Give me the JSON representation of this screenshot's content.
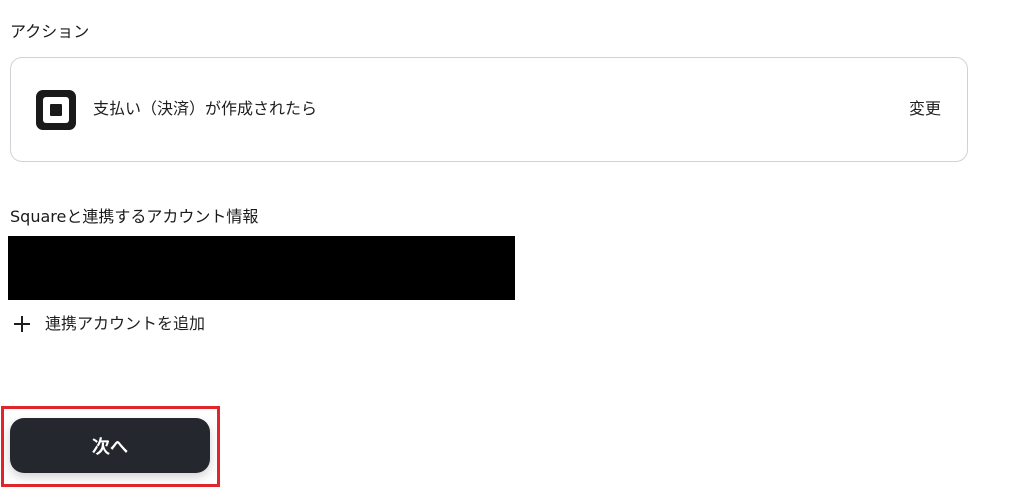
{
  "action_section": {
    "label": "アクション",
    "card": {
      "app_icon": "square-logo-icon",
      "title": "支払い（決済）が作成されたら",
      "change_label": "変更"
    }
  },
  "account_section": {
    "label": "Squareと連携するアカウント情報",
    "add_account_icon": "plus-icon",
    "add_account_label": "連携アカウントを追加"
  },
  "footer": {
    "next_label": "次へ"
  },
  "colors": {
    "button_bg": "#24272e",
    "highlight_border": "#e0262b",
    "card_border": "#cfd3d8",
    "redacted": "#000000"
  }
}
